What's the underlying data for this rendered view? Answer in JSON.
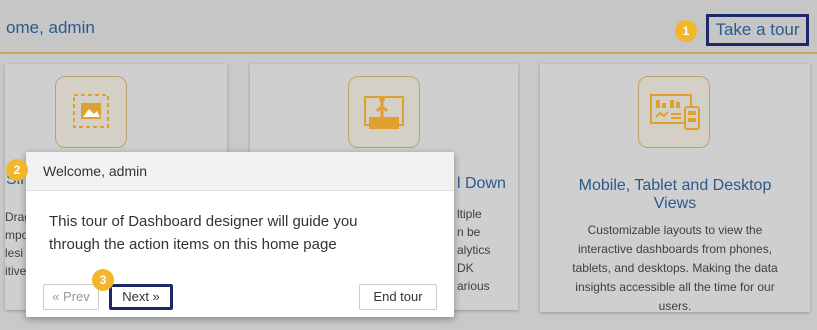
{
  "header": {
    "title": "ome, admin",
    "tour_button": "Take a tour",
    "tour_badge": "1"
  },
  "cards": {
    "left": {
      "fragments": [
        "Drag",
        "mpo",
        "lesi",
        "itive"
      ]
    },
    "middle": {
      "title_fragment": "l Down",
      "fragments": [
        "ltiple",
        "n be",
        "alytics",
        "DK",
        "arious"
      ]
    },
    "right": {
      "title": "Mobile, Tablet and Desktop Views",
      "description": "Customizable layouts to view the interactive dashboards from phones, tablets, and desktops. Making the data insights accessible all the time for our users."
    }
  },
  "left_title_fragment": "Sim",
  "popup": {
    "badge": "2",
    "title": "Welcome, admin",
    "body": "This tour of Dashboard designer will guide you through the action items on this home page",
    "prev": "« Prev",
    "next": "Next »",
    "next_badge": "3",
    "end": "End tour"
  },
  "colors": {
    "accent_badge": "#f2b62a",
    "highlight_border": "#1d2869",
    "link_blue": "#2a5a8e"
  }
}
